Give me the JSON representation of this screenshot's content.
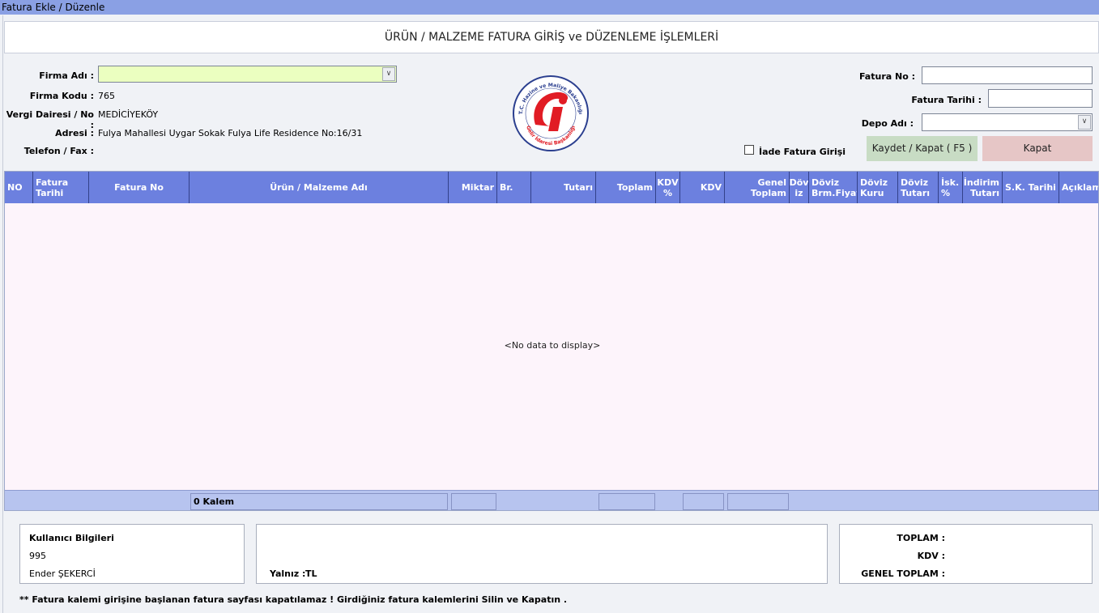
{
  "window": {
    "title": "Fatura Ekle / Düzenle"
  },
  "header": {
    "title": "ÜRÜN / MALZEME FATURA GİRİŞ ve DÜZENLEME İŞLEMLERİ"
  },
  "firm": {
    "name_label": "Firma Adı :",
    "name_value": "",
    "code_label": "Firma Kodu :",
    "code_value": "765",
    "tax_label": "Vergi Dairesi / No :",
    "tax_value": "MEDİCİYEKÖY",
    "address_label": "Adresi :",
    "address_value": "Fulya Mahallesi Uygar Sokak Fulya Life Residence No:16/31",
    "phone_label": "Telefon / Fax :",
    "phone_value": ""
  },
  "logo": {
    "ring_top": "T.C. Hazine ve Maliye Bakanlığı",
    "ring_bottom": "Gelir İdaresi Başkanlığı",
    "letter": "Gİ"
  },
  "invoice": {
    "no_label": "Fatura No :",
    "no_value": "",
    "date_label": "Fatura Tarihi :",
    "date_value": "",
    "depot_label": "Depo Adı :",
    "depot_value": "",
    "return_label": "İade Fatura Girişi",
    "return_checked": false
  },
  "buttons": {
    "save": "Kaydet / Kapat ( F5 )",
    "close": "Kapat"
  },
  "grid": {
    "columns": [
      "NO",
      "Fatura Tarihi",
      "Fatura No",
      "Ürün / Malzeme Adı",
      "Miktar",
      "Br.",
      "Tutarı",
      "Toplam",
      "KDV\n%",
      "KDV",
      "Genel Toplam",
      "Döv\niz",
      "Döviz\nBrm.Fiyat",
      "Döviz\nKuru",
      "Döviz\nTutarı",
      "İsk.\n%",
      "İndirim\nTutarı",
      "S.K. Tarihi",
      "Açıklama"
    ],
    "rows": [],
    "empty_text": "<No data to display>",
    "footer_count": "0 Kalem"
  },
  "user": {
    "title": "Kullanıcı Bilgileri",
    "id": "995",
    "name": "Ender ŞEKERCİ"
  },
  "amount_words": {
    "label": "Yalnız :",
    "currency": "TL"
  },
  "totals": {
    "total_label": "TOPLAM :",
    "vat_label": "KDV :",
    "grand_label": "GENEL TOPLAM :"
  },
  "footer_note": "** Fatura kalemi girişine başlanan fatura sayfası kapatılamaz ! Girdiğiniz fatura kalemlerini Silin ve Kapatın .",
  "colors": {
    "titlebar": "#8aa0e4",
    "grid_header": "#6c80df",
    "grid_body": "#fdf4fb",
    "combo": "#ebffc0",
    "save_button": "#c8dcc4",
    "close_button": "#e6c6c6",
    "logo_red": "#e11c24",
    "logo_blue": "#2b3f8f"
  }
}
